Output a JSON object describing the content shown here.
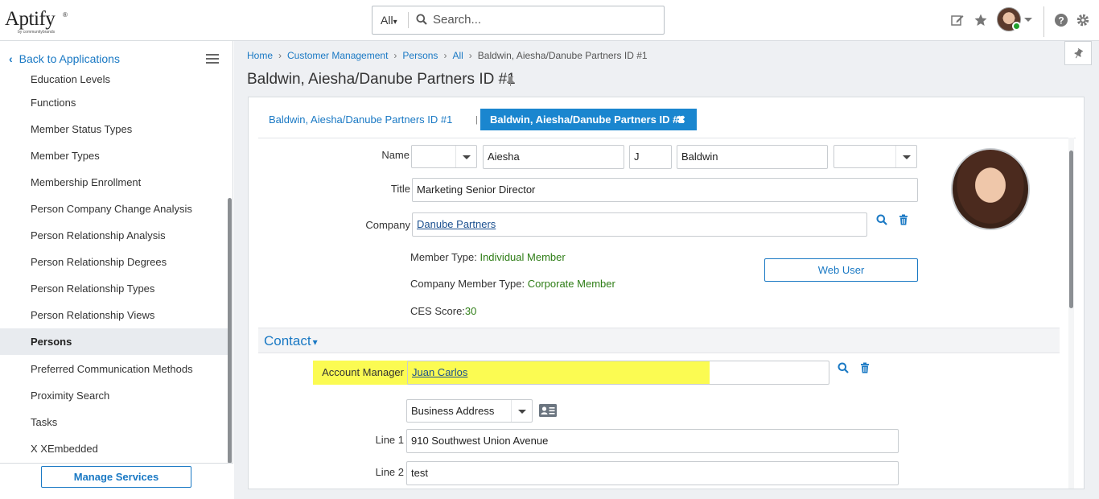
{
  "header": {
    "logo_text": "Aptify",
    "logo_sub": "by communitybrands",
    "search_scope": "All",
    "search_placeholder": "Search..."
  },
  "sidebar": {
    "back_label": "Back to Applications",
    "items": [
      {
        "label": "Education Levels"
      },
      {
        "label": "Functions"
      },
      {
        "label": "Member Status Types"
      },
      {
        "label": "Member Types"
      },
      {
        "label": "Membership Enrollment"
      },
      {
        "label": "Person Company Change Analysis"
      },
      {
        "label": "Person Relationship Analysis"
      },
      {
        "label": "Person Relationship Degrees"
      },
      {
        "label": "Person Relationship Types"
      },
      {
        "label": "Person Relationship Views"
      },
      {
        "label": "Persons",
        "active": true
      },
      {
        "label": "Preferred Communication Methods"
      },
      {
        "label": "Proximity Search"
      },
      {
        "label": "Tasks"
      },
      {
        "label": "X XEmbedded"
      }
    ],
    "manage_services_label": "Manage Services"
  },
  "breadcrumb": [
    "Home",
    "Customer Management",
    "Persons",
    "All",
    "Baldwin, Aiesha/Danube Partners ID #1"
  ],
  "page_title": "Baldwin, Aiesha/Danube Partners ID #1",
  "tabs": {
    "tab1": "Baldwin, Aiesha/Danube Partners ID #1",
    "separator": "|",
    "tab2": "Baldwin, Aiesha/Danube Partners ID #1",
    "tab2_close": "✖"
  },
  "form": {
    "name_label": "Name",
    "prefix": "",
    "first_name": "Aiesha",
    "middle_initial": "J",
    "last_name": "Baldwin",
    "suffix": "",
    "title_label": "Title",
    "title_value": "Marketing Senior Director",
    "company_label": "Company",
    "company_value": "Danube Partners",
    "member_type_label": "Member Type: ",
    "member_type_value": "Individual Member",
    "company_member_type_label": "Company Member Type: ",
    "company_member_type_value": "Corporate Member",
    "ces_label": "CES Score:",
    "ces_value": "30",
    "web_user_label": "Web User"
  },
  "contact": {
    "section_title": "Contact",
    "caret": "▾",
    "account_manager_label": "Account Manager",
    "account_manager_value": "Juan Carlos",
    "address_type": "Business Address",
    "line1_label": "Line 1",
    "line1_value": "910 Southwest Union Avenue",
    "line2_label": "Line 2",
    "line2_value": "test"
  },
  "colors": {
    "accent": "#1a79c4",
    "active_tab": "#1a86cf",
    "highlight": "#fbfb52",
    "value_green": "#2e7d16"
  }
}
